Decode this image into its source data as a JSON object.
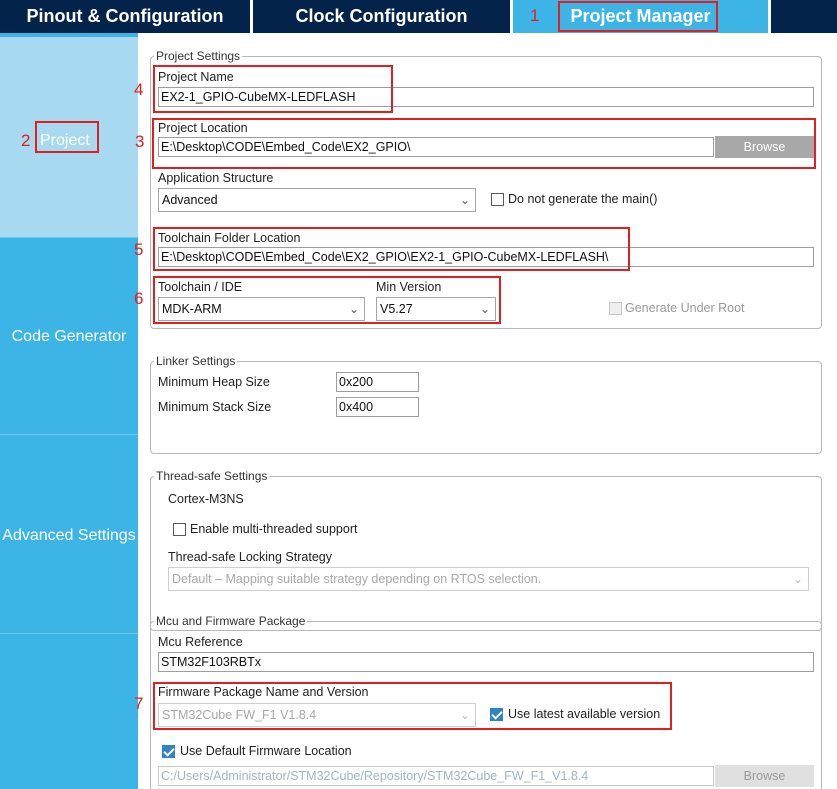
{
  "tabs": [
    {
      "label": "Pinout & Configuration"
    },
    {
      "label": "Clock Configuration"
    },
    {
      "label": "Project Manager"
    }
  ],
  "sidebar": {
    "items": [
      {
        "label": "Project"
      },
      {
        "label": "Code Generator"
      },
      {
        "label": "Advanced Settings"
      }
    ]
  },
  "annotations": [
    "1",
    "2",
    "3",
    "4",
    "5",
    "6",
    "7"
  ],
  "project_settings": {
    "legend": "Project Settings",
    "project_name_label": "Project Name",
    "project_name_value": "EX2-1_GPIO-CubeMX-LEDFLASH",
    "project_location_label": "Project Location",
    "project_location_value": "E:\\Desktop\\CODE\\Embed_Code\\EX2_GPIO\\",
    "browse_label": "Browse",
    "app_structure_label": "Application Structure",
    "app_structure_value": "Advanced",
    "no_main_label": "Do not generate the main()",
    "toolchain_folder_label": "Toolchain Folder Location",
    "toolchain_folder_value": "E:\\Desktop\\CODE\\Embed_Code\\EX2_GPIO\\EX2-1_GPIO-CubeMX-LEDFLASH\\",
    "toolchain_label": "Toolchain / IDE",
    "toolchain_value": "MDK-ARM",
    "min_version_label": "Min Version",
    "min_version_value": "V5.27",
    "generate_under_root_label": "Generate Under Root"
  },
  "linker_settings": {
    "legend": "Linker Settings",
    "heap_label": "Minimum Heap Size",
    "heap_value": "0x200",
    "stack_label": "Minimum Stack Size",
    "stack_value": "0x400"
  },
  "thread_safe": {
    "legend": "Thread-safe Settings",
    "core": "Cortex-M3NS",
    "multithread_label": "Enable multi-threaded support",
    "strategy_label": "Thread-safe Locking Strategy",
    "strategy_value": "Default  –  Mapping suitable strategy depending on RTOS selection."
  },
  "mcu_firmware": {
    "legend": "Mcu and Firmware Package",
    "mcu_ref_label": "Mcu Reference",
    "mcu_ref_value": "STM32F103RBTx",
    "fw_label": "Firmware Package Name and Version",
    "fw_value": "STM32Cube FW_F1 V1.8.4",
    "use_latest_label": "Use latest available version",
    "use_default_location_label": "Use Default Firmware Location",
    "fw_location_value": "C:/Users/Administrator/STM32Cube/Repository/STM32Cube_FW_F1_V1.8.4",
    "browse_label": "Browse"
  },
  "colors": {
    "tab_dark": "#03234b",
    "tab_active": "#3cb4e6",
    "sidebar": "#3cb4e6",
    "sidebar_selected": "#a7daf1",
    "annotation_red": "#e02020",
    "checkbox_checked": "#2e84c9"
  }
}
